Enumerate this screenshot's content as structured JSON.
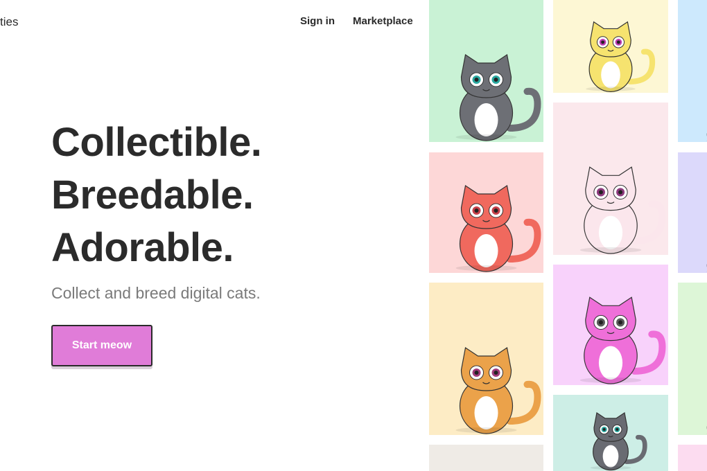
{
  "brand": {
    "name": "ties"
  },
  "nav": {
    "sign_in": "Sign in",
    "marketplace": "Marketplace"
  },
  "hero": {
    "line1": "Collectible.",
    "line2": "Breedable.",
    "line3": "Adorable.",
    "subtitle": "Collect and breed digital cats.",
    "cta_label": "Start meow"
  },
  "cats": [
    {
      "name": "grey-tabby-cat",
      "bg": "#c9f2d5",
      "fur": "#6d6f75",
      "eye": "#2aa8a0"
    },
    {
      "name": "yellow-cat",
      "bg": "#fdf7d4",
      "fur": "#f6e36f",
      "eye": "#c03bb2"
    },
    {
      "name": "red-cat",
      "bg": "#fdd7d7",
      "fur": "#f0695e",
      "eye": "#c7414a"
    },
    {
      "name": "pale-pink-cat",
      "bg": "#fbe8ec",
      "fur": "#fbe6ec",
      "eye": "#8e3b7e"
    },
    {
      "name": "orange-spotted-cat",
      "bg": "#fdecc5",
      "fur": "#eba24a",
      "eye": "#a13c7b"
    },
    {
      "name": "magenta-cat",
      "bg": "#f8d2fb",
      "fur": "#ef6fd9",
      "eye": "#5a5a5a"
    },
    {
      "name": "grey-cat-bottom",
      "bg": "#cdeee6",
      "fur": "#696b72",
      "eye": "#2aa8a0"
    },
    {
      "name": "beige-tile",
      "bg": "#efebe6"
    },
    {
      "name": "blue-tile",
      "bg": "#cde9fd",
      "fur": "#9b6fe0"
    },
    {
      "name": "lavender-tile",
      "bg": "#dcd9fb",
      "fur": "#4e4a6f"
    },
    {
      "name": "light-green-tile",
      "bg": "#ddf6d7",
      "fur": "#3fb06a"
    },
    {
      "name": "pink-tile-bottom",
      "bg": "#fcdcf0"
    }
  ]
}
